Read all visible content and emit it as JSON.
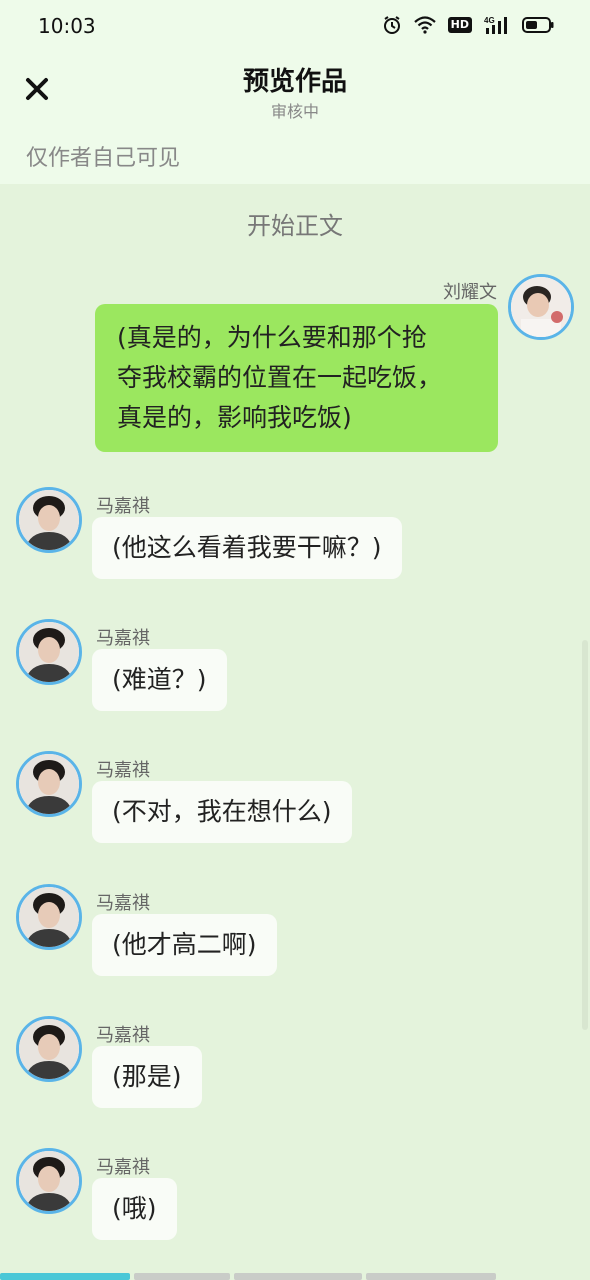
{
  "status_bar": {
    "time": "10:03",
    "icons": [
      "alarm-icon",
      "wifi-icon",
      "hd-icon",
      "4g-signal-icon",
      "battery-icon"
    ],
    "hd_label": "HD",
    "network_label": "4G"
  },
  "header": {
    "title": "预览作品",
    "subtitle": "审核中",
    "visibility_note": "仅作者自己可见"
  },
  "content": {
    "section_title": "开始正文"
  },
  "messages": [
    {
      "side": "right",
      "name": "刘耀文",
      "text_lines": [
        "(真是的，为什么要和那个抢",
        "夺我校霸的位置在一起吃饭，",
        "真是的，影响我吃饭)"
      ]
    },
    {
      "side": "left",
      "name": "马嘉祺",
      "text": "(他这么看着我要干嘛？)"
    },
    {
      "side": "left",
      "name": "马嘉祺",
      "text": "(难道？)"
    },
    {
      "side": "left",
      "name": "马嘉祺",
      "text": "(不对，我在想什么)"
    },
    {
      "side": "left",
      "name": "马嘉祺",
      "text": "(他才高二啊)"
    },
    {
      "side": "left",
      "name": "马嘉祺",
      "text": "(那是)"
    },
    {
      "side": "left",
      "name": "马嘉祺",
      "text": "(哦)"
    }
  ],
  "colors": {
    "background": "#e4f3dc",
    "header_background": "#eefbea",
    "right_bubble": "#9be75f",
    "left_bubble": "#f9fcf7",
    "avatar_ring": "#5ab4e8",
    "progress_active": "#4ac7d7"
  }
}
